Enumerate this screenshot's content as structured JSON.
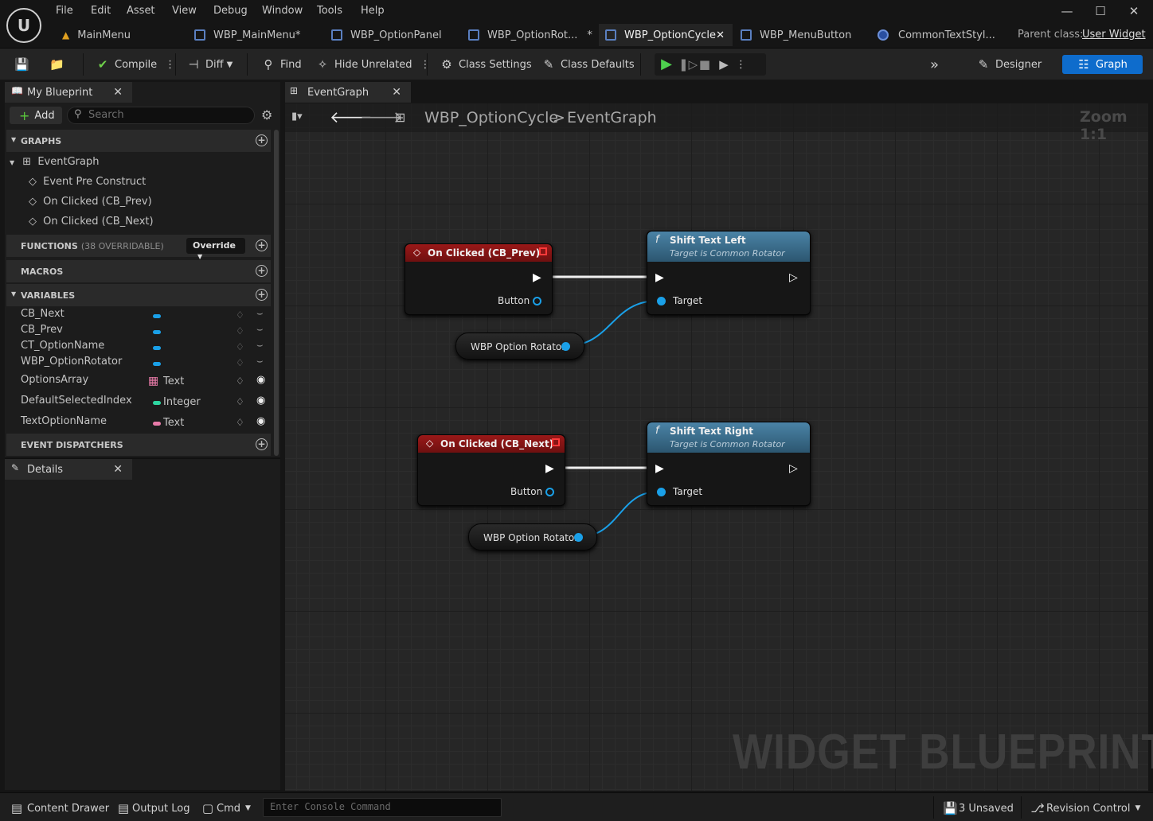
{
  "menu": [
    "File",
    "Edit",
    "Asset",
    "View",
    "Debug",
    "Window",
    "Tools",
    "Help"
  ],
  "tabs": [
    {
      "label": "MainMenu"
    },
    {
      "label": "WBP_MainMenu*"
    },
    {
      "label": "WBP_OptionPanel"
    },
    {
      "label": "WBP_OptionRot..."
    },
    {
      "label": "WBP_OptionCycle"
    },
    {
      "label": "WBP_MenuButton"
    },
    {
      "label": "CommonTextStyl..."
    }
  ],
  "modified_mark": "*",
  "parent_class": {
    "label": "Parent class:",
    "value": "User Widget"
  },
  "toolbar": {
    "compile": "Compile",
    "diff": "Diff",
    "find": "Find",
    "hide_unrelated": "Hide Unrelated",
    "class_settings": "Class Settings",
    "class_defaults": "Class Defaults",
    "designer": "Designer",
    "graph": "Graph"
  },
  "my_blueprint": {
    "tab": "My Blueprint",
    "add": "Add",
    "search_placeholder": "Search",
    "graphs": "GRAPHS",
    "event_graph": "EventGraph",
    "events": [
      "Event Pre Construct",
      "On Clicked (CB_Prev)",
      "On Clicked (CB_Next)"
    ],
    "functions": "FUNCTIONS",
    "functions_count": "(38 OVERRIDABLE)",
    "override": "Override",
    "macros": "MACROS",
    "variables": "VARIABLES",
    "event_dispatchers": "EVENT DISPATCHERS",
    "vars": [
      {
        "name": "CB_Next",
        "type": ""
      },
      {
        "name": "CB_Prev",
        "type": ""
      },
      {
        "name": "CT_OptionName",
        "type": ""
      },
      {
        "name": "WBP_OptionRotator",
        "type": ""
      },
      {
        "name": "OptionsArray",
        "type": "Text"
      },
      {
        "name": "DefaultSelectedIndex",
        "type": "Integer"
      },
      {
        "name": "TextOptionName",
        "type": "Text"
      }
    ]
  },
  "details": {
    "tab": "Details"
  },
  "graph": {
    "tab": "EventGraph",
    "breadcrumb_root": "WBP_OptionCycle",
    "breadcrumb_sep": ">",
    "breadcrumb_leaf": "EventGraph",
    "zoom": "Zoom 1:1",
    "watermark": "WIDGET BLUEPRINT",
    "nodes": {
      "prev_event": {
        "title": "On Clicked (CB_Prev)",
        "pin": "Button"
      },
      "left_fn": {
        "title": "Shift Text Left",
        "subtitle": "Target is Common Rotator",
        "pin": "Target"
      },
      "rot1": {
        "label": "WBP Option Rotator"
      },
      "next_event": {
        "title": "On Clicked (CB_Next)",
        "pin": "Button"
      },
      "right_fn": {
        "title": "Shift Text Right",
        "subtitle": "Target is Common Rotator",
        "pin": "Target"
      },
      "rot2": {
        "label": "WBP Option Rotator"
      }
    }
  },
  "status": {
    "content_drawer": "Content Drawer",
    "output_log": "Output Log",
    "cmd": "Cmd",
    "console_placeholder": "Enter Console Command",
    "unsaved": "3 Unsaved",
    "revision": "Revision Control"
  },
  "colors": {
    "accent": "#0e6ccc",
    "event_header": "#8b1414",
    "function_header": "#3d6f8c",
    "pin_blue": "#1aa0e8",
    "pin_pink": "#e87aa8",
    "pin_green": "#2ed6a0"
  }
}
